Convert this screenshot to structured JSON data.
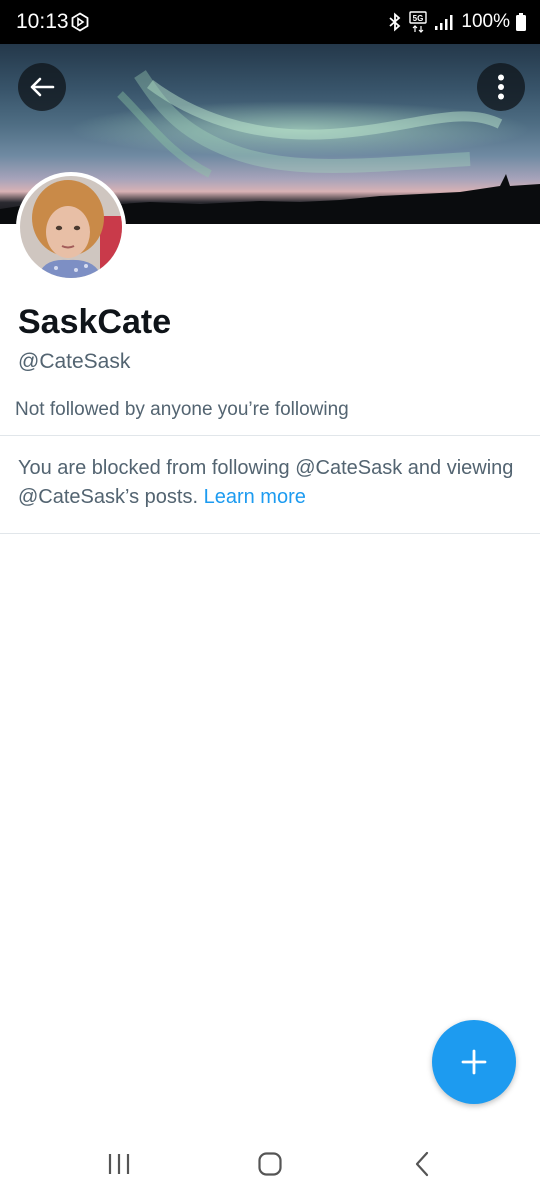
{
  "status_bar": {
    "time": "10:13",
    "battery": "100%",
    "icons": [
      "app-notification-icon",
      "bluetooth-icon",
      "5g-icon",
      "signal-icon",
      "battery-icon"
    ]
  },
  "header": {
    "back_icon": "arrow-left-icon",
    "more_icon": "more-vertical-icon"
  },
  "profile": {
    "display_name": "SaskCate",
    "handle": "@CateSask",
    "followed_by": "Not followed by anyone you’re following"
  },
  "blocked_notice": {
    "text": "You are blocked from following @CateSask and viewing @CateSask’s posts.",
    "link_text": "Learn more"
  },
  "fab": {
    "icon": "plus-icon"
  },
  "nav_bar": {
    "icons": [
      "recent-apps-icon",
      "home-icon",
      "back-icon"
    ]
  },
  "colors": {
    "accent": "#1d9bf0",
    "secondary_text": "#536471",
    "primary_text": "#0f1419",
    "divider": "#e1e6ea"
  }
}
